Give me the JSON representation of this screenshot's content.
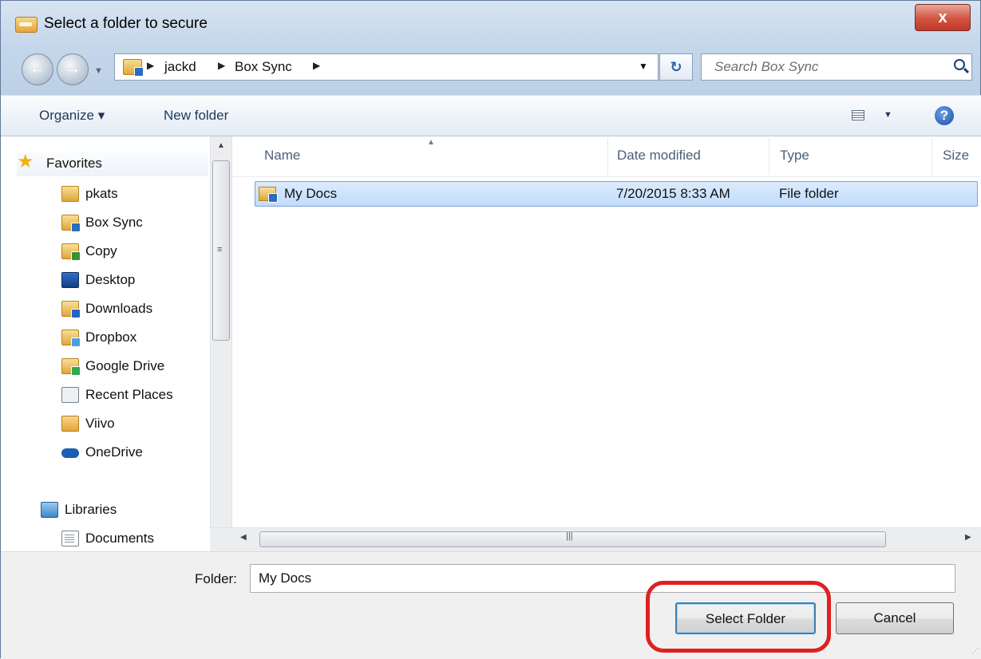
{
  "window": {
    "title": "Select a folder to secure",
    "close_label": "x"
  },
  "nav": {
    "back_label": "←",
    "forward_label": "→",
    "breadcrumbs": [
      "jackd",
      "Box Sync"
    ],
    "refresh_label": "↻",
    "search_placeholder": "Search Box Sync"
  },
  "toolbar": {
    "organize_label": "Organize ▾",
    "new_folder_label": "New folder",
    "help_label": "?"
  },
  "sidebar": {
    "favorites_label": "Favorites",
    "items": [
      {
        "label": "pkats",
        "icon": "folder-icon"
      },
      {
        "label": "Box Sync",
        "icon": "box-sync-folder-icon"
      },
      {
        "label": "Copy",
        "icon": "copy-folder-icon"
      },
      {
        "label": "Desktop",
        "icon": "desktop-icon"
      },
      {
        "label": "Downloads",
        "icon": "downloads-folder-icon"
      },
      {
        "label": "Dropbox",
        "icon": "dropbox-folder-icon"
      },
      {
        "label": "Google Drive",
        "icon": "google-drive-folder-icon"
      },
      {
        "label": "Recent Places",
        "icon": "recent-places-icon"
      },
      {
        "label": "Viivo",
        "icon": "viivo-icon"
      },
      {
        "label": "OneDrive",
        "icon": "onedrive-icon"
      }
    ],
    "libraries_label": "Libraries",
    "library_items": [
      {
        "label": "Documents",
        "icon": "documents-icon"
      }
    ]
  },
  "file_list": {
    "columns": [
      "Name",
      "Date modified",
      "Type",
      "Size"
    ],
    "rows": [
      {
        "name": "My Docs",
        "date_modified": "7/20/2015 8:33 AM",
        "type": "File folder",
        "size": ""
      }
    ]
  },
  "footer": {
    "folder_label": "Folder:",
    "folder_value": "My Docs",
    "select_button": "Select Folder",
    "cancel_button": "Cancel"
  },
  "colors": {
    "highlight": "#e02020",
    "selection": "#c1dcfb",
    "close_button": "#d25340"
  }
}
